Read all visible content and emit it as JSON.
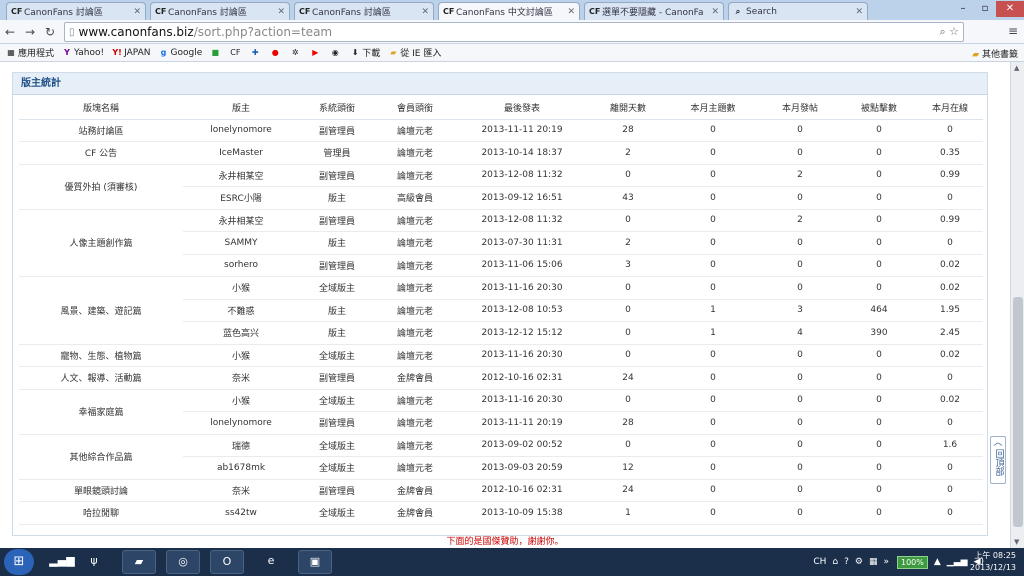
{
  "browser": {
    "tabs": [
      {
        "label": "CanonFans 討論區",
        "active": false
      },
      {
        "label": "CanonFans 討論區",
        "active": false
      },
      {
        "label": "CanonFans 討論區",
        "active": false
      },
      {
        "label": "CanonFans 中文討論區",
        "active": true
      },
      {
        "label": "選單不要隱藏 - CanonFa",
        "active": false
      },
      {
        "label": "Search",
        "active": false
      }
    ],
    "url_host": "www.canonfans.biz",
    "url_path": "/sort.php?action=team",
    "bookmarks": [
      "應用程式",
      "Yahoo!",
      "JAPAN",
      "Google",
      "",
      "",
      "",
      "",
      "",
      "",
      "",
      "下載",
      "從 IE 匯入"
    ],
    "other_bookmarks": "其他書籤"
  },
  "panel": {
    "title": "版主統計",
    "headers": [
      "版塊名稱",
      "版主",
      "系統頭銜",
      "會員頭銜",
      "最後發表",
      "離開天數",
      "本月主題數",
      "本月發帖",
      "被點擊數",
      "本月在線"
    ],
    "rows": [
      {
        "forum": "站務討論區",
        "span": 1,
        "mod": "lonelynomore",
        "sys": "副管理員",
        "title": "論壇元老",
        "last": "2013-11-11 20:19",
        "away": "28",
        "topics": "0",
        "posts": "0",
        "clicks": "0",
        "online": "0"
      },
      {
        "forum": "CF 公告",
        "span": 1,
        "mod": "IceMaster",
        "sys": "管理員",
        "title": "論壇元老",
        "last": "2013-10-14 18:37",
        "away": "2",
        "topics": "0",
        "posts": "0",
        "clicks": "0",
        "online": "0.35"
      },
      {
        "forum": "優質外拍 (須審核)",
        "span": 2,
        "mod": "永井相某空",
        "sys": "副管理員",
        "title": "論壇元老",
        "last": "2013-12-08 11:32",
        "away": "0",
        "topics": "0",
        "posts": "2",
        "clicks": "0",
        "online": "0.99"
      },
      {
        "forum": "",
        "span": 0,
        "mod": "ESRC小陽",
        "sys": "版主",
        "title": "高級會員",
        "last": "2013-09-12 16:51",
        "away": "43",
        "topics": "0",
        "posts": "0",
        "clicks": "0",
        "online": "0"
      },
      {
        "forum": "人像主題創作篇",
        "span": 3,
        "mod": "永井相某空",
        "sys": "副管理員",
        "title": "論壇元老",
        "last": "2013-12-08 11:32",
        "away": "0",
        "topics": "0",
        "posts": "2",
        "clicks": "0",
        "online": "0.99"
      },
      {
        "forum": "",
        "span": 0,
        "mod": "SAMMY",
        "sys": "版主",
        "title": "論壇元老",
        "last": "2013-07-30 11:31",
        "away": "2",
        "topics": "0",
        "posts": "0",
        "clicks": "0",
        "online": "0"
      },
      {
        "forum": "",
        "span": 0,
        "mod": "sorhero",
        "sys": "副管理員",
        "title": "論壇元老",
        "last": "2013-11-06 15:06",
        "away": "3",
        "topics": "0",
        "posts": "0",
        "clicks": "0",
        "online": "0.02"
      },
      {
        "forum": "風景、建築、遊記篇",
        "span": 3,
        "mod": "小猴",
        "sys": "全域版主",
        "title": "論壇元老",
        "last": "2013-11-16 20:30",
        "away": "0",
        "topics": "0",
        "posts": "0",
        "clicks": "0",
        "online": "0.02"
      },
      {
        "forum": "",
        "span": 0,
        "mod": "不難惑",
        "sys": "版主",
        "title": "論壇元老",
        "last": "2013-12-08 10:53",
        "away": "0",
        "topics": "1",
        "posts": "3",
        "clicks": "464",
        "online": "1.95"
      },
      {
        "forum": "",
        "span": 0,
        "mod": "蓝色高兴",
        "sys": "版主",
        "title": "論壇元老",
        "last": "2013-12-12 15:12",
        "away": "0",
        "topics": "1",
        "posts": "4",
        "clicks": "390",
        "online": "2.45"
      },
      {
        "forum": "寵物、生態、植物篇",
        "span": 1,
        "mod": "小猴",
        "sys": "全域版主",
        "title": "論壇元老",
        "last": "2013-11-16 20:30",
        "away": "0",
        "topics": "0",
        "posts": "0",
        "clicks": "0",
        "online": "0.02"
      },
      {
        "forum": "人文、報導、活動篇",
        "span": 1,
        "mod": "奈米",
        "sys": "副管理員",
        "title": "金牌會員",
        "last": "2012-10-16 02:31",
        "away": "24",
        "topics": "0",
        "posts": "0",
        "clicks": "0",
        "online": "0"
      },
      {
        "forum": "幸福家庭篇",
        "span": 2,
        "mod": "小猴",
        "sys": "全域版主",
        "title": "論壇元老",
        "last": "2013-11-16 20:30",
        "away": "0",
        "topics": "0",
        "posts": "0",
        "clicks": "0",
        "online": "0.02"
      },
      {
        "forum": "",
        "span": 0,
        "mod": "lonelynomore",
        "sys": "副管理員",
        "title": "論壇元老",
        "last": "2013-11-11 20:19",
        "away": "28",
        "topics": "0",
        "posts": "0",
        "clicks": "0",
        "online": "0"
      },
      {
        "forum": "其他綜合作品篇",
        "span": 2,
        "mod": "瑞德",
        "sys": "全域版主",
        "title": "論壇元老",
        "last": "2013-09-02 00:52",
        "away": "0",
        "topics": "0",
        "posts": "0",
        "clicks": "0",
        "online": "1.6"
      },
      {
        "forum": "",
        "span": 0,
        "mod": "ab1678mk",
        "sys": "全域版主",
        "title": "論壇元老",
        "last": "2013-09-03 20:59",
        "away": "12",
        "topics": "0",
        "posts": "0",
        "clicks": "0",
        "online": "0"
      },
      {
        "forum": "單眼鏡頭討論",
        "span": 1,
        "mod": "奈米",
        "sys": "副管理員",
        "title": "金牌會員",
        "last": "2012-10-16 02:31",
        "away": "24",
        "topics": "0",
        "posts": "0",
        "clicks": "0",
        "online": "0"
      },
      {
        "forum": "哈拉閒聊",
        "span": 1,
        "mod": "ss42tw",
        "sys": "全域版主",
        "title": "金牌會員",
        "last": "2013-10-09 15:38",
        "away": "1",
        "topics": "0",
        "posts": "0",
        "clicks": "0",
        "online": "0"
      }
    ]
  },
  "footer_note": "下面的是國傑贊助，謝謝你。",
  "back_to_top": "回頂部",
  "taskbar": {
    "lang": "CH",
    "battery": "100%",
    "time": "上午 08:25",
    "date": "2013/12/13"
  }
}
